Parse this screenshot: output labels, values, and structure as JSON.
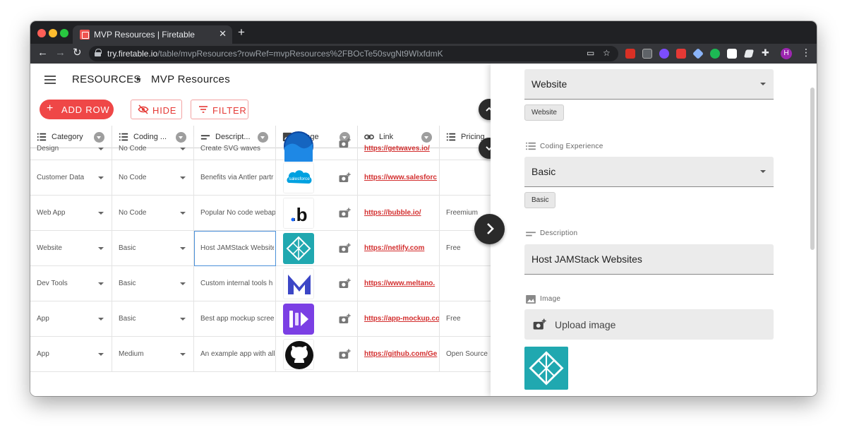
{
  "browser": {
    "tab_title": "MVP Resources | Firetable",
    "tab_close": "✕",
    "new_tab": "+",
    "url_host": "try.firetable.io",
    "url_path": "/table/mvpResources?rowRef=mvpResources%2FBOcTe50svgNt9WIxfdmK",
    "profile_initial": "H",
    "extension_colors": [
      "#d93025",
      "#5f6368",
      "#7c4dff",
      "#e53935",
      "#8ab4f8",
      "#1db954",
      "#ffffff",
      "#e8eaed",
      "#e8eaed"
    ]
  },
  "header": {
    "breadcrumb_root": "RESOURCES",
    "breadcrumb_sep": "▸",
    "page_title": "MVP Resources"
  },
  "actions": {
    "add_row": "ADD ROW",
    "hide": "HIDE",
    "filter": "FILTER"
  },
  "columns": [
    {
      "label": "Category",
      "icon": "list-icon"
    },
    {
      "label": "Coding ...",
      "icon": "list-icon"
    },
    {
      "label": "Descript...",
      "icon": "short-text-icon"
    },
    {
      "label": "Image",
      "icon": "image-icon"
    },
    {
      "label": "Link",
      "icon": "link-icon"
    },
    {
      "label": "Pricing",
      "icon": "list-icon"
    }
  ],
  "rows": [
    {
      "category": "Design",
      "coding": "No Code",
      "description": "Create SVG waves",
      "image": "getwaves-logo",
      "link": "https://getwaves.io/",
      "pricing": ""
    },
    {
      "category": "Customer Data",
      "coding": "No Code",
      "description": "Benefits via Antler partr",
      "image": "salesforce-logo",
      "image_text": "salesforce",
      "link": "https://www.salesforc",
      "pricing": ""
    },
    {
      "category": "Web App",
      "coding": "No Code",
      "description": "Popular No code webap",
      "image": "bubble-logo",
      "image_text": ".b",
      "link": "https://bubble.io/",
      "pricing": "Freemium"
    },
    {
      "category": "Website",
      "coding": "Basic",
      "description": "Host JAMStack Websites",
      "image": "netlify-logo",
      "link": "https://netlify.com",
      "pricing": "Free"
    },
    {
      "category": "Dev Tools",
      "coding": "Basic",
      "description": "Custom internal tools h",
      "image": "meltano-logo",
      "link": "https://www.meltano.",
      "pricing": ""
    },
    {
      "category": "App",
      "coding": "Basic",
      "description": "Best app mockup scree",
      "image": "app-mockup-logo",
      "link": "https://app-mockup.co",
      "pricing": "Free"
    },
    {
      "category": "App",
      "coding": "Medium",
      "description": "An example app with all",
      "image": "github-logo",
      "link": "https://github.com/Ge",
      "pricing": "Open Source"
    }
  ],
  "panel": {
    "category_value": "Website",
    "category_chip": "Website",
    "coding_label": "Coding Experience",
    "coding_value": "Basic",
    "coding_chip": "Basic",
    "description_label": "Description",
    "description_value": "Host JAMStack Websites",
    "image_label": "Image",
    "upload_label": "Upload image"
  },
  "colors": {
    "accent": "#ef4747",
    "link": "#d32f2f",
    "netlify_teal": "#20a8b0"
  }
}
